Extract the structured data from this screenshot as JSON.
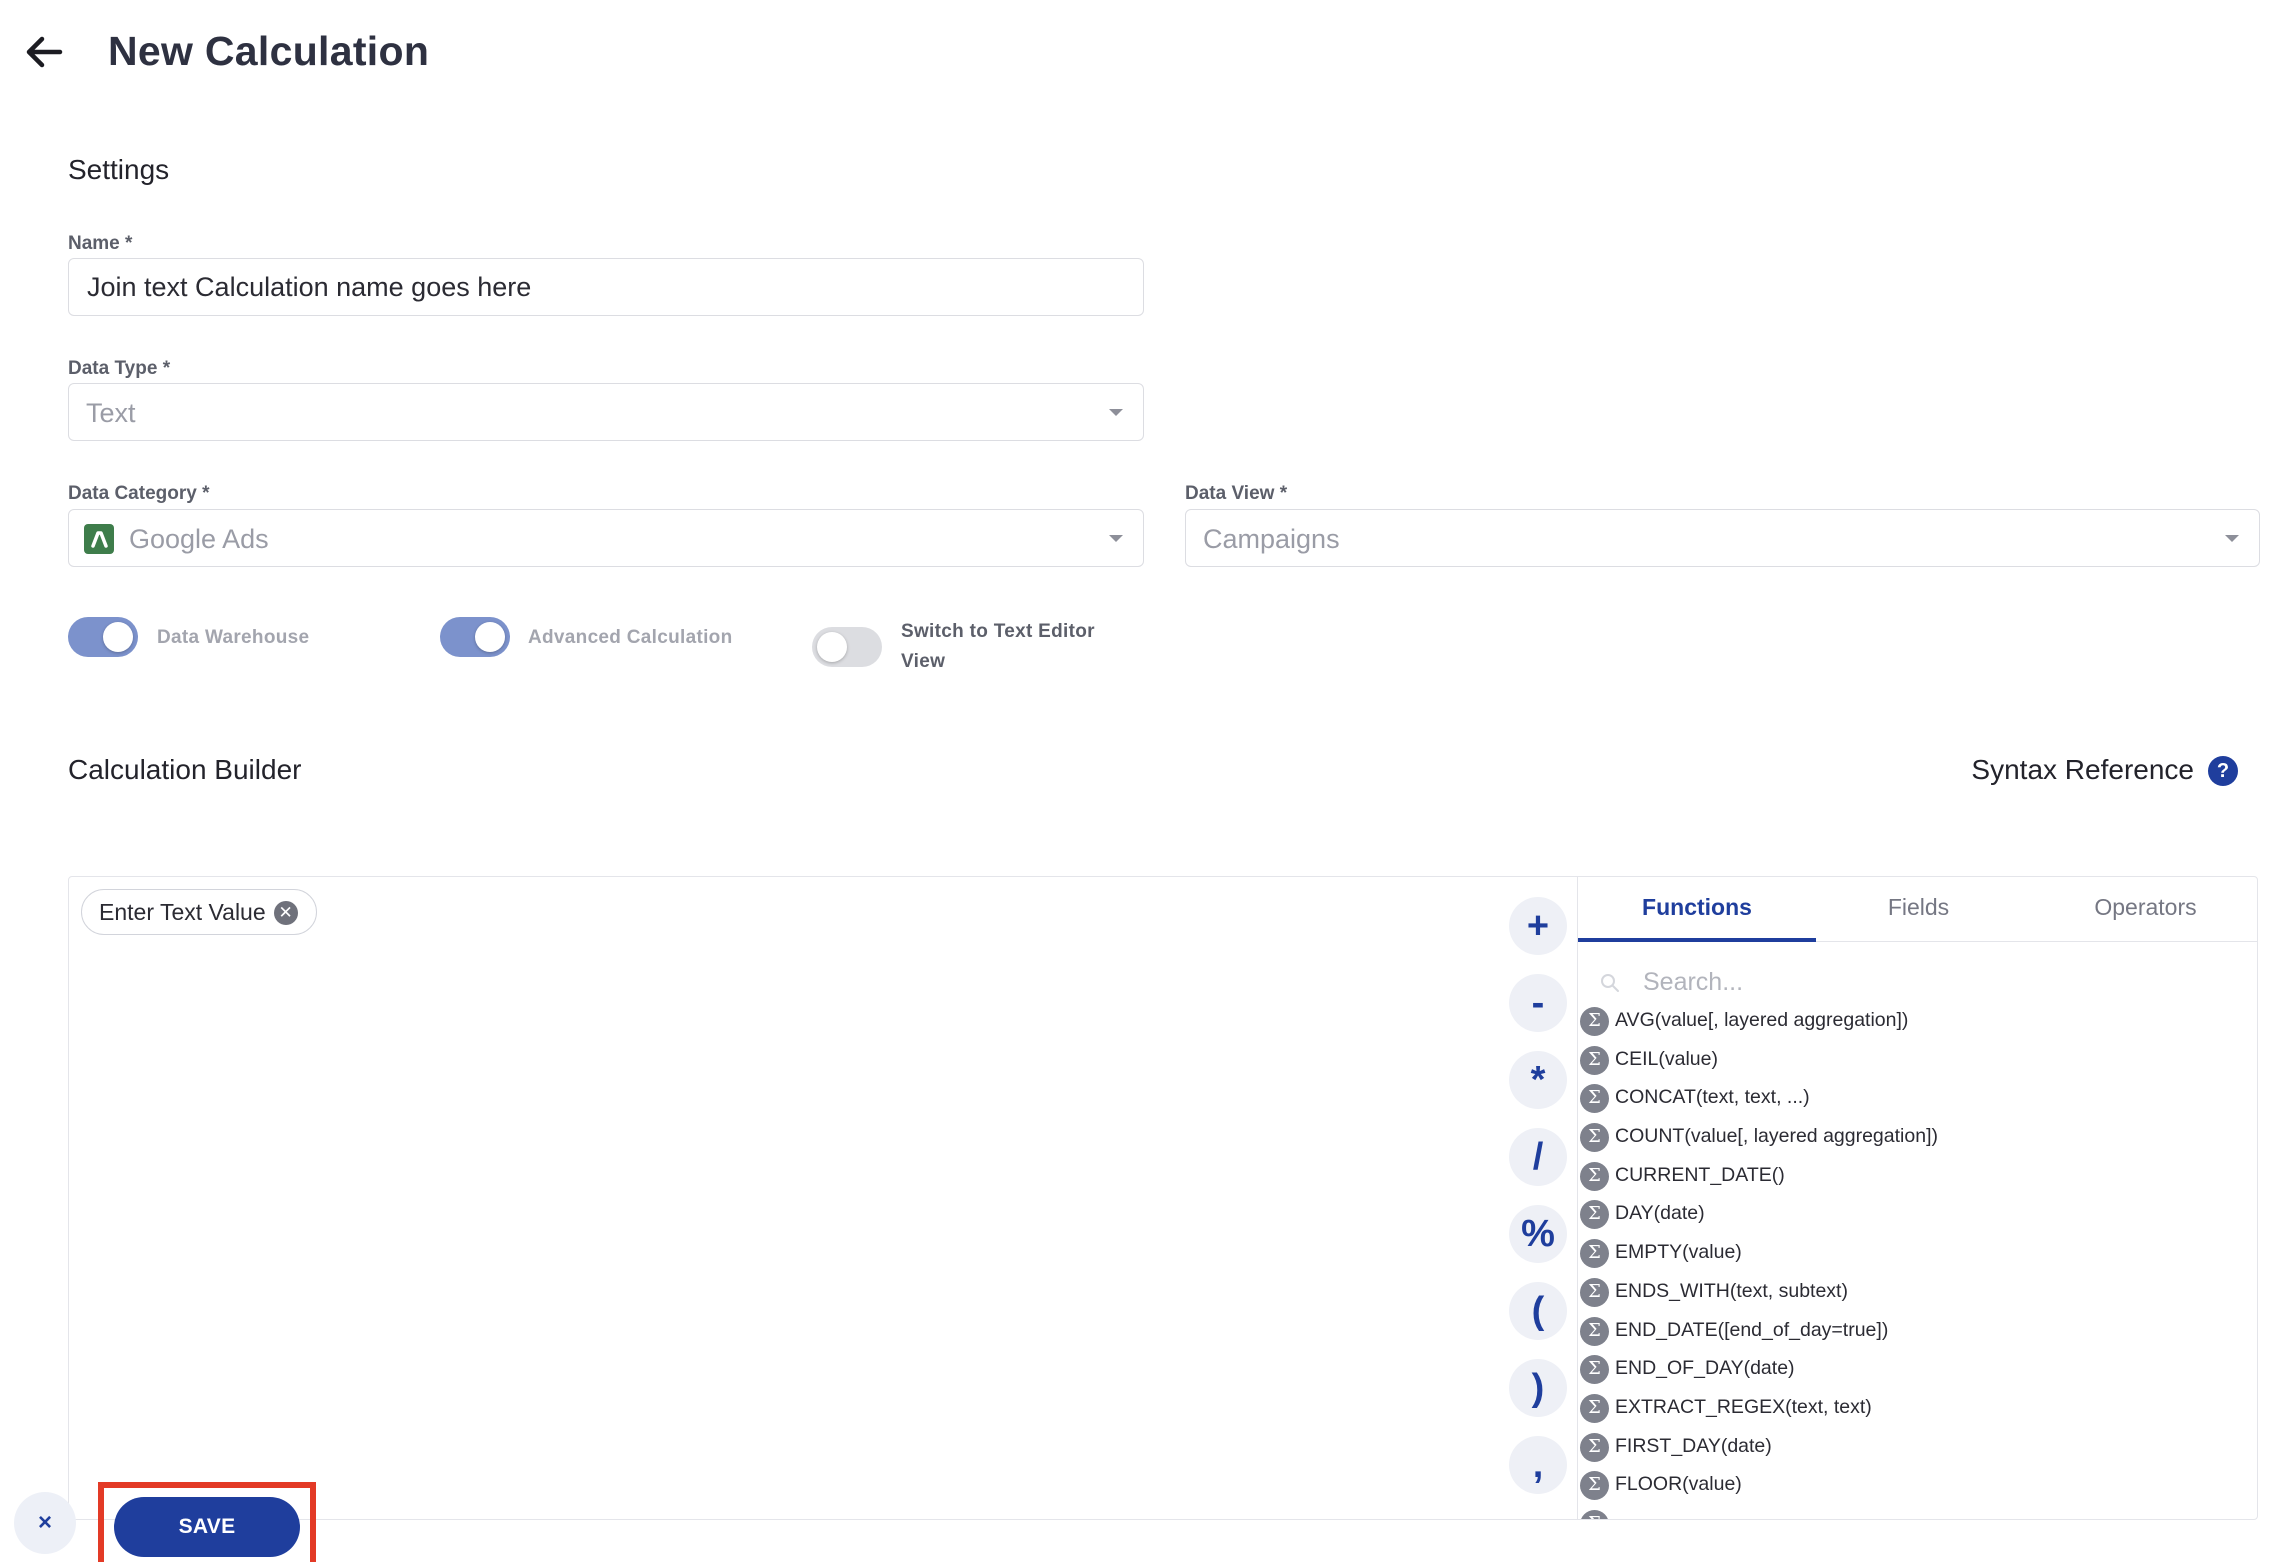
{
  "header": {
    "title": "New Calculation"
  },
  "settings": {
    "section_title": "Settings",
    "name_label": "Name",
    "name_value": "Join text Calculation name goes here",
    "data_type_label": "Data Type",
    "data_type_value": "Text",
    "data_category_label": "Data Category",
    "data_category_value": "Google Ads",
    "data_view_label": "Data View",
    "data_view_value": "Campaigns",
    "required_mark": "*"
  },
  "toggles": [
    {
      "label": "Data Warehouse",
      "on": true
    },
    {
      "label": "Advanced Calculation",
      "on": true
    },
    {
      "label_line1": "Switch to Text Editor",
      "label_line2": "View",
      "on": false
    }
  ],
  "builder": {
    "section_title": "Calculation Builder",
    "syntax_reference": "Syntax Reference",
    "help_icon": "?",
    "chip": "Enter Text Value",
    "chip_remove": "✕",
    "operators": [
      "+",
      "-",
      "*",
      "/",
      "%",
      "(",
      ")",
      ","
    ]
  },
  "panel": {
    "tabs": [
      "Functions",
      "Fields",
      "Operators"
    ],
    "active_tab": "Functions",
    "search_placeholder": "Search...",
    "fn_icon": "Σ",
    "functions": [
      "AVG(value[, layered aggregation])",
      "CEIL(value)",
      "CONCAT(text, text, ...)",
      "COUNT(value[, layered aggregation])",
      "CURRENT_DATE()",
      "DAY(date)",
      "EMPTY(value)",
      "ENDS_WITH(text, subtext)",
      "END_DATE([end_of_day=true])",
      "END_OF_DAY(date)",
      "EXTRACT_REGEX(text, text)",
      "FIRST_DAY(date)",
      "FLOOR(value)",
      ""
    ]
  },
  "footer": {
    "cancel": "×",
    "save": "SAVE"
  },
  "colors": {
    "primary": "#1f3e9d",
    "toggle_on": "#7c92cc",
    "highlight": "#e33a26",
    "google_ads": "#3e7d4b"
  },
  "icons": {
    "back": "arrow-left-icon",
    "help": "question-circle-icon",
    "search": "search-icon",
    "function": "sigma-icon"
  }
}
